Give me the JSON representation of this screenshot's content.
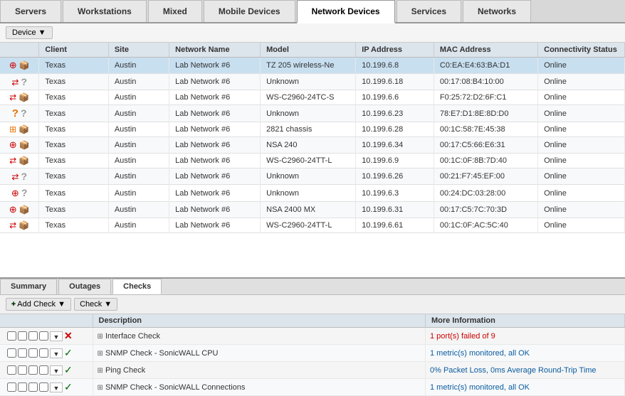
{
  "tabs": [
    {
      "id": "servers",
      "label": "Servers",
      "active": false
    },
    {
      "id": "workstations",
      "label": "Workstations",
      "active": false
    },
    {
      "id": "mixed",
      "label": "Mixed",
      "active": false
    },
    {
      "id": "mobile",
      "label": "Mobile Devices",
      "active": false
    },
    {
      "id": "network-devices",
      "label": "Network Devices",
      "active": true
    },
    {
      "id": "services",
      "label": "Services",
      "active": false
    },
    {
      "id": "networks",
      "label": "Networks",
      "active": false
    }
  ],
  "toolbar": {
    "device_label": "Device ▼"
  },
  "table": {
    "headers": [
      "",
      "Client",
      "Site",
      "Network Name",
      "Model",
      "IP Address",
      "MAC Address",
      "Connectivity Status"
    ],
    "rows": [
      {
        "icon": "wifi-red",
        "icon2": "box",
        "client": "Texas",
        "site": "Austin",
        "network": "Lab Network #6",
        "model": "TZ 205 wireless-Ne",
        "ip": "10.199.6.8",
        "mac": "C0:EA:E4:63:BA:D1",
        "status": "Online",
        "selected": true
      },
      {
        "icon": "arrows-red",
        "icon2": "question",
        "client": "Texas",
        "site": "Austin",
        "network": "Lab Network #6",
        "model": "Unknown",
        "ip": "10.199.6.18",
        "mac": "00:17:08:B4:10:00",
        "status": "Online",
        "selected": false
      },
      {
        "icon": "arrows-red",
        "icon2": "box",
        "client": "Texas",
        "site": "Austin",
        "network": "Lab Network #6",
        "model": "WS-C2960-24TC-S",
        "ip": "10.199.6.6",
        "mac": "F0:25:72:D2:6F:C1",
        "status": "Online",
        "selected": false
      },
      {
        "icon": "question-orange",
        "icon2": "question",
        "client": "Texas",
        "site": "Austin",
        "network": "Lab Network #6",
        "model": "Unknown",
        "ip": "10.199.6.23",
        "mac": "78:E7:D1:8E:8D:D0",
        "status": "Online",
        "selected": false
      },
      {
        "icon": "rack-orange",
        "icon2": "box",
        "client": "Texas",
        "site": "Austin",
        "network": "Lab Network #6",
        "model": "2821 chassis",
        "ip": "10.199.6.28",
        "mac": "00:1C:58:7E:45:38",
        "status": "Online",
        "selected": false
      },
      {
        "icon": "wifi-red",
        "icon2": "box",
        "client": "Texas",
        "site": "Austin",
        "network": "Lab Network #6",
        "model": "NSA 240",
        "ip": "10.199.6.34",
        "mac": "00:17:C5:66:E6:31",
        "status": "Online",
        "selected": false
      },
      {
        "icon": "arrows-red",
        "icon2": "box",
        "client": "Texas",
        "site": "Austin",
        "network": "Lab Network #6",
        "model": "WS-C2960-24TT-L",
        "ip": "10.199.6.9",
        "mac": "00:1C:0F:8B:7D:40",
        "status": "Online",
        "selected": false
      },
      {
        "icon": "arrows-red",
        "icon2": "question",
        "client": "Texas",
        "site": "Austin",
        "network": "Lab Network #6",
        "model": "Unknown",
        "ip": "10.199.6.26",
        "mac": "00:21:F7:45:EF:00",
        "status": "Online",
        "selected": false
      },
      {
        "icon": "wifi-red",
        "icon2": "question",
        "client": "Texas",
        "site": "Austin",
        "network": "Lab Network #6",
        "model": "Unknown",
        "ip": "10.199.6.3",
        "mac": "00:24:DC:03:28:00",
        "status": "Online",
        "selected": false
      },
      {
        "icon": "wifi-red",
        "icon2": "box",
        "client": "Texas",
        "site": "Austin",
        "network": "Lab Network #6",
        "model": "NSA 2400 MX",
        "ip": "10.199.6.31",
        "mac": "00:17:C5:7C:70:3D",
        "status": "Online",
        "selected": false
      },
      {
        "icon": "arrows-red",
        "icon2": "box",
        "client": "Texas",
        "site": "Austin",
        "network": "Lab Network #6",
        "model": "WS-C2960-24TT-L",
        "ip": "10.199.6.61",
        "mac": "00:1C:0F:AC:5C:40",
        "status": "Online",
        "selected": false
      }
    ]
  },
  "bottom": {
    "tabs": [
      {
        "id": "summary",
        "label": "Summary",
        "active": false
      },
      {
        "id": "outages",
        "label": "Outages",
        "active": false
      },
      {
        "id": "checks",
        "label": "Checks",
        "active": true
      }
    ],
    "add_check_label": "+ Add Check ▼",
    "check_label": "Check ▼",
    "checks_headers": [
      "Description",
      "More Information"
    ],
    "checks": [
      {
        "status": "x",
        "desc_icon": "net",
        "description": "Interface Check",
        "more": "1 port(s) failed of 9",
        "more_type": "red"
      },
      {
        "status": "check",
        "desc_icon": "net",
        "description": "SNMP Check - SonicWALL CPU",
        "more": "1 metric(s) monitored, all OK",
        "more_type": "blue"
      },
      {
        "status": "check",
        "desc_icon": "net",
        "description": "Ping Check",
        "more": "0% Packet Loss, 0ms Average Round-Trip Time",
        "more_type": "blue"
      },
      {
        "status": "check",
        "desc_icon": "net",
        "description": "SNMP Check - SonicWALL Connections",
        "more": "1 metric(s) monitored, all OK",
        "more_type": "blue"
      }
    ]
  }
}
